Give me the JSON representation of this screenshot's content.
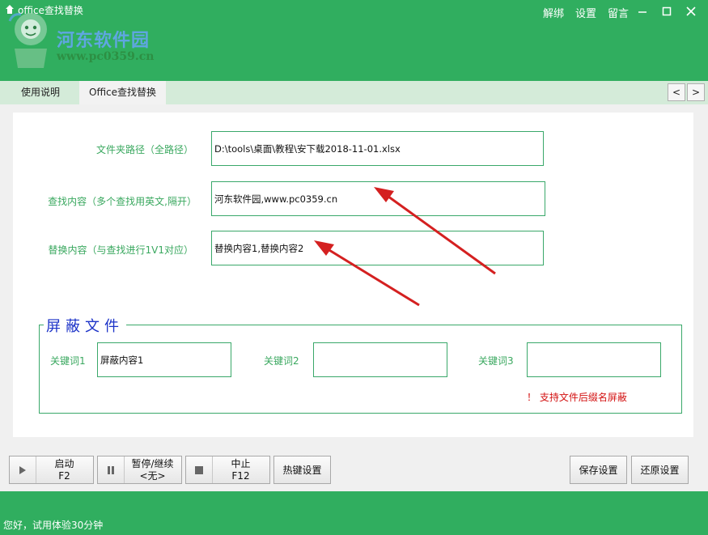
{
  "window": {
    "title": "office查找替换",
    "links": [
      "解绑",
      "设置",
      "留言"
    ],
    "controls": [
      "minimize-icon",
      "maximize-icon",
      "close-icon"
    ]
  },
  "watermark": {
    "name": "河东软件园",
    "url": "www.pc0359.cn"
  },
  "tabs": [
    {
      "label": "使用说明",
      "active": false
    },
    {
      "label": "Office查找替换",
      "active": true
    }
  ],
  "tab_nav": {
    "prev": "<",
    "next": ">"
  },
  "form": {
    "folder_label": "文件夹路径（全路径）",
    "folder_value": "D:\\tools\\桌面\\教程\\安下载2018-11-01.xlsx",
    "find_label": "查找内容（多个查找用英文,隔开）",
    "find_value": "河东软件园,www.pc0359.cn",
    "replace_label": "替换内容（与查找进行1V1对应）",
    "replace_value": "替换内容1,替换内容2"
  },
  "shield": {
    "title": "屏蔽文件",
    "keyword1_label": "关键词1",
    "keyword1_value": "屏蔽内容1",
    "keyword2_label": "关键词2",
    "keyword2_value": "",
    "keyword3_label": "关键词3",
    "keyword3_value": "",
    "notice": "！ 支持文件后缀名屏蔽"
  },
  "buttons": {
    "start_label": "启动",
    "start_key": "F2",
    "pause_label": "暂停/继续",
    "pause_key": "<无>",
    "stop_label": "中止",
    "stop_key": "F12",
    "hotkey_label": "热键设置",
    "save_label": "保存设置",
    "restore_label": "还原设置"
  },
  "status": {
    "text": "您好，试用体验30分钟"
  },
  "colors": {
    "brand_green": "#30ae5f",
    "label_green": "#3aa85f",
    "group_title_blue": "#1c33c8",
    "warning_red": "#d31111",
    "arrow_red": "#d42020"
  }
}
